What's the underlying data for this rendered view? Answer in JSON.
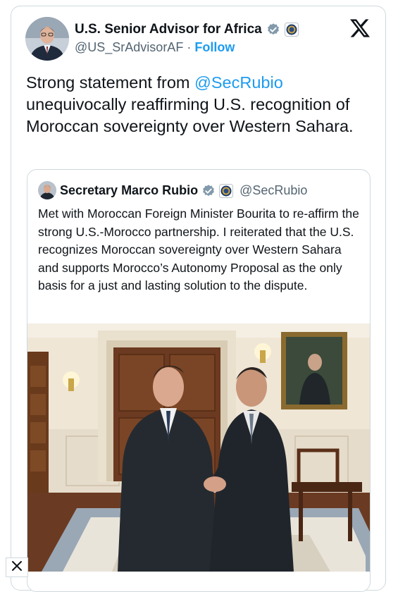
{
  "author": {
    "name": "U.S. Senior Advisor for Africa",
    "handle": "@US_SrAdvisorAF",
    "separator": "·",
    "follow_label": "Follow"
  },
  "tweet": {
    "text_before": "Strong statement from ",
    "mention": "@SecRubio",
    "text_after": " unequivocally reaffirming U.S. recognition of Moroccan sovereignty over Western Sahara."
  },
  "quoted": {
    "name": "Secretary Marco Rubio",
    "handle": "@SecRubio",
    "text": "Met with Moroccan Foreign Minister Bourita to re-affirm the strong U.S.-Morocco partnership. I reiterated that the U.S. recognizes Moroccan sovereignty over Western Sahara and supports Morocco’s Autonomy Proposal as the only basis for a just and lasting solution to the dispute."
  },
  "icons": {
    "verified": "verified-badge-icon",
    "government_seal": "government-seal-icon",
    "platform_logo": "x-logo-icon",
    "close": "close-icon"
  },
  "colors": {
    "link": "#1d9bf0",
    "verified": "#829aab",
    "text": "#0f1419",
    "secondary": "#536471"
  }
}
